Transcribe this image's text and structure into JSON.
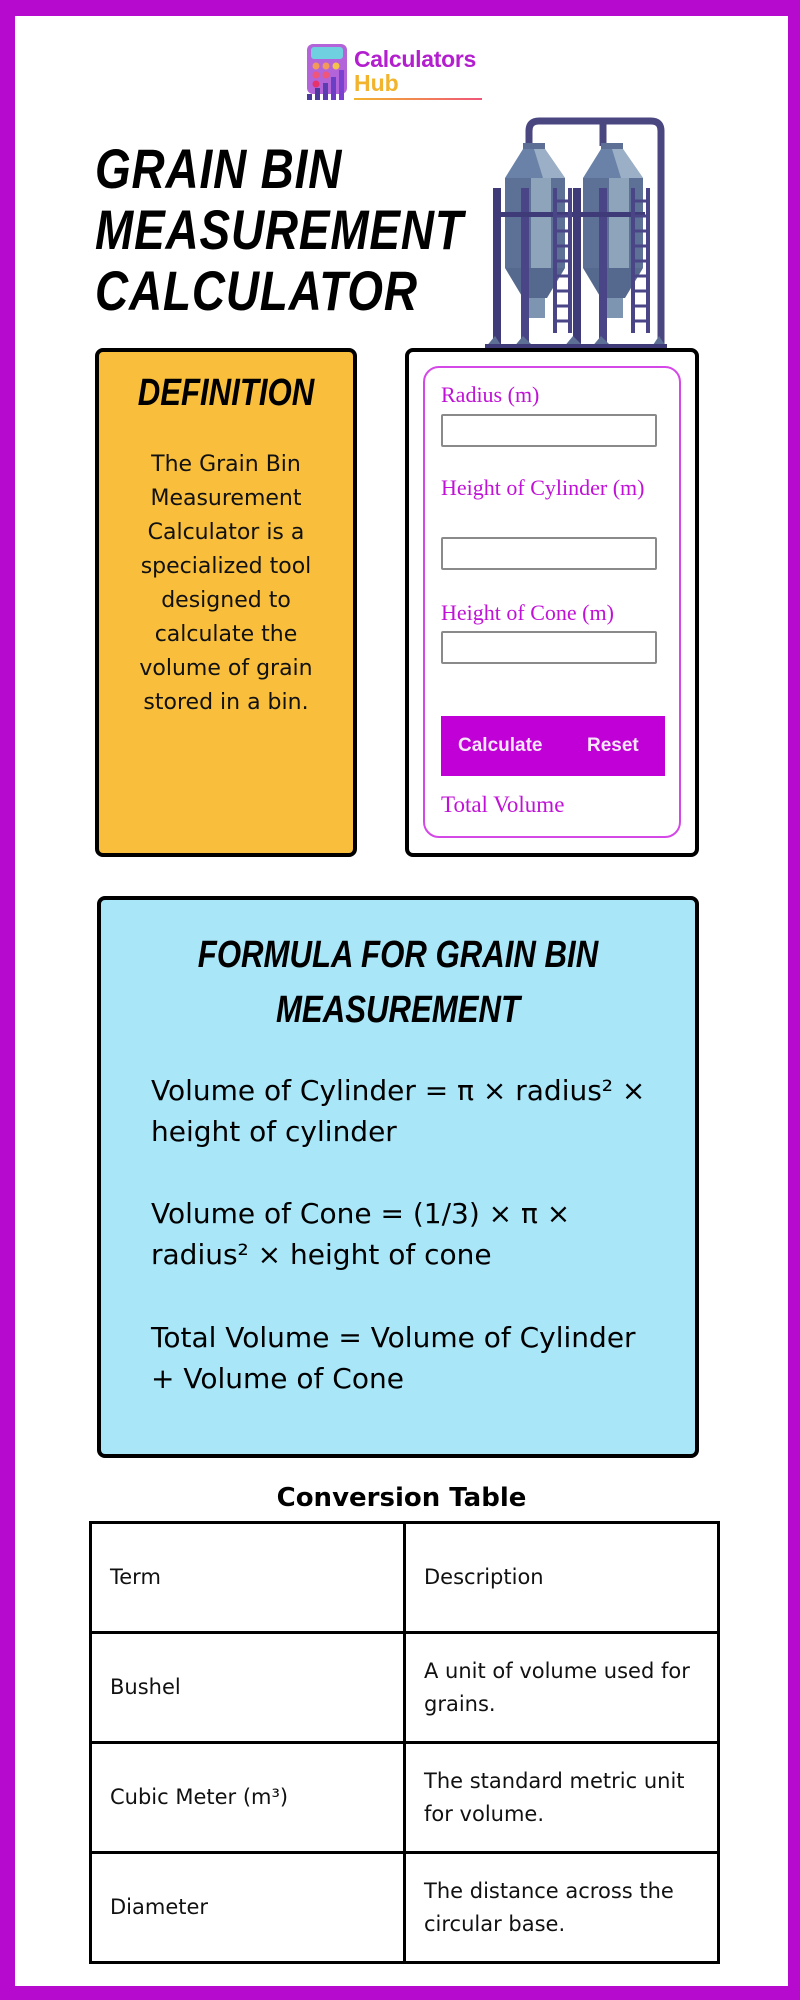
{
  "brand": {
    "name_line1": "Calculators",
    "name_line2": "Hub",
    "colors": {
      "frame": "#b60ace",
      "brand_purple": "#b31fcf",
      "brand_yellow": "#f2b42c"
    }
  },
  "header": {
    "title": "GRAIN BIN MEASUREMENT CALCULATOR",
    "illustration": "grain-silo-icon"
  },
  "definition": {
    "title": "DEFINITION",
    "text": "The Grain Bin Measurement Calculator is a specialized tool designed to calculate the volume of grain stored in a bin.",
    "bg_color": "#f8be3c"
  },
  "calculator": {
    "fields": [
      {
        "label": "Radius (m)",
        "value": "",
        "placeholder": ""
      },
      {
        "label": "Height of Cylinder (m)",
        "value": "",
        "placeholder": ""
      },
      {
        "label": "Height of Cone (m)",
        "value": "",
        "placeholder": ""
      }
    ],
    "calculate_label": "Calculate",
    "reset_label": "Reset",
    "result_label": "Total Volume",
    "accent_color": "#c000d6"
  },
  "formula": {
    "title": "FORMULA FOR GRAIN BIN MEASUREMENT",
    "lines": [
      "Volume of Cylinder = π × radius² × height of cylinder",
      "Volume of Cone = (1/3) × π × radius² × height of cone",
      "Total Volume = Volume of Cylinder + Volume of Cone"
    ],
    "bg_color": "#a8e6f8"
  },
  "conversion_table": {
    "title": "Conversion Table",
    "headers": [
      "Term",
      "Description"
    ],
    "rows": [
      [
        "Bushel",
        "A unit of volume used for grains."
      ],
      [
        "Cubic Meter (m³)",
        "The standard metric unit for volume."
      ],
      [
        "Diameter",
        "The distance across the circular base."
      ]
    ]
  }
}
